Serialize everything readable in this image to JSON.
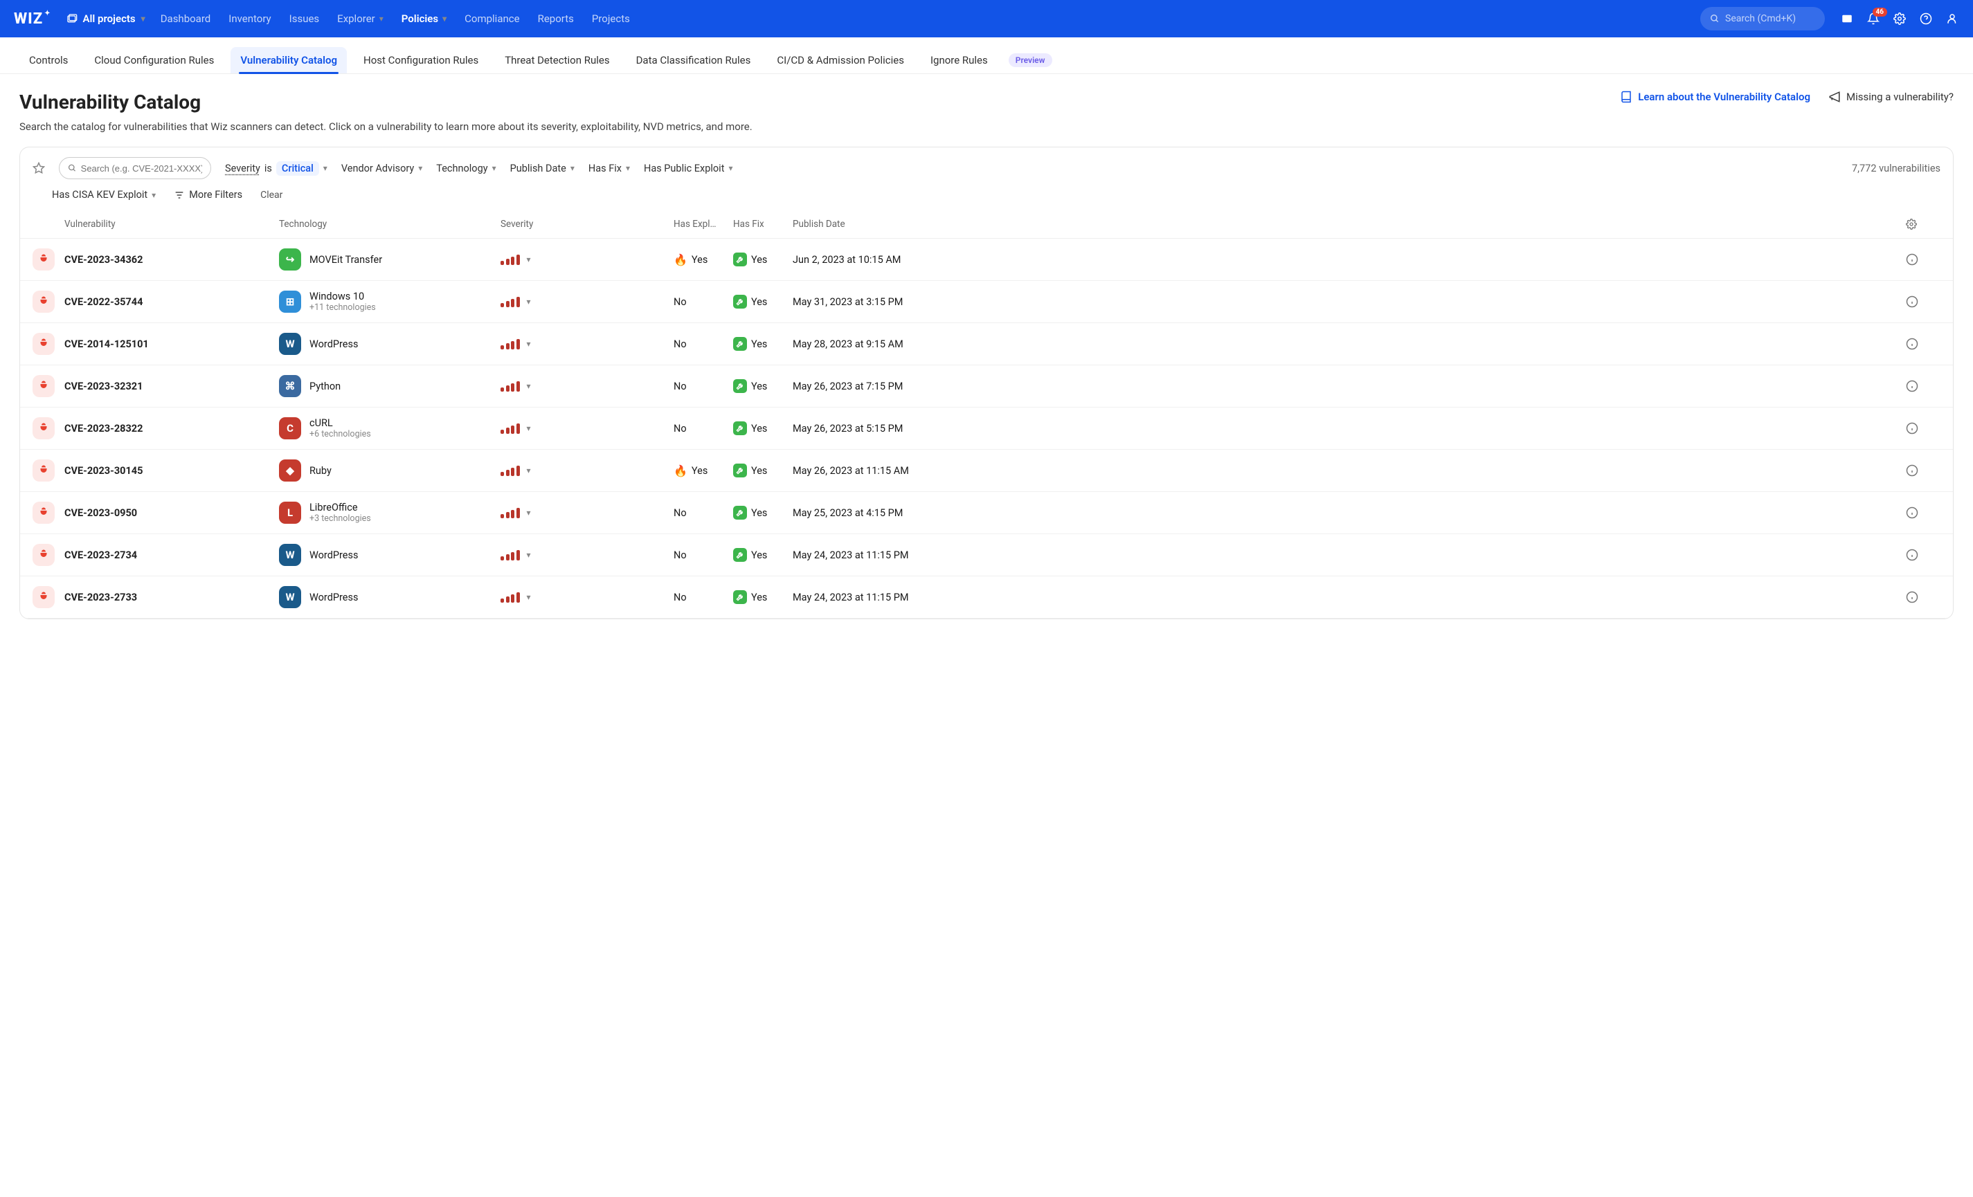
{
  "brand": "WIZ",
  "project_selector": "All projects",
  "nav": {
    "items": [
      "Dashboard",
      "Inventory",
      "Issues",
      "Explorer",
      "Policies",
      "Compliance",
      "Reports",
      "Projects"
    ],
    "active": "Policies",
    "search_placeholder": "Search (Cmd+K)",
    "notification_count": "46"
  },
  "subtabs": {
    "items": [
      "Controls",
      "Cloud Configuration Rules",
      "Vulnerability Catalog",
      "Host Configuration Rules",
      "Threat Detection Rules",
      "Data Classification Rules",
      "CI/CD & Admission Policies",
      "Ignore Rules"
    ],
    "active": "Vulnerability Catalog",
    "preview_label": "Preview"
  },
  "page": {
    "title": "Vulnerability Catalog",
    "learn_link": "Learn about the Vulnerability Catalog",
    "missing_link": "Missing a vulnerability?",
    "description": "Search the catalog for vulnerabilities that Wiz scanners can detect. Click on a vulnerability to learn more about its severity, exploitability, NVD metrics, and more."
  },
  "filters": {
    "search_placeholder": "Search (e.g. CVE-2021-XXXX)",
    "severity_label": "Severity",
    "is_label": "is",
    "severity_value": "Critical",
    "vendor": "Vendor Advisory",
    "technology": "Technology",
    "publish": "Publish Date",
    "has_fix": "Has Fix",
    "public_exploit": "Has Public Exploit",
    "cisa": "Has CISA KEV Exploit",
    "more": "More Filters",
    "clear": "Clear",
    "count": "7,772 vulnerabilities"
  },
  "columns": {
    "vuln": "Vulnerability",
    "tech": "Technology",
    "sev": "Severity",
    "expl": "Has Expl…",
    "fix": "Has Fix",
    "date": "Publish Date"
  },
  "rows": [
    {
      "cve": "CVE-2023-34362",
      "tech": "MOVEit Transfer",
      "sub": "",
      "color": "#3cb54b",
      "glyph": "↪",
      "expl": "Yes",
      "fire": true,
      "fix": "Yes",
      "date": "Jun 2, 2023 at 10:15 AM"
    },
    {
      "cve": "CVE-2022-35744",
      "tech": "Windows 10",
      "sub": "+11 technologies",
      "color": "#2f8fd8",
      "glyph": "⊞",
      "expl": "No",
      "fire": false,
      "fix": "Yes",
      "date": "May 31, 2023 at 3:15 PM"
    },
    {
      "cve": "CVE-2014-125101",
      "tech": "WordPress",
      "sub": "",
      "color": "#1a5a8a",
      "glyph": "W",
      "expl": "No",
      "fire": false,
      "fix": "Yes",
      "date": "May 28, 2023 at 9:15 AM"
    },
    {
      "cve": "CVE-2023-32321",
      "tech": "Python",
      "sub": "",
      "color": "#3b6aa0",
      "glyph": "⌘",
      "expl": "No",
      "fire": false,
      "fix": "Yes",
      "date": "May 26, 2023 at 7:15 PM"
    },
    {
      "cve": "CVE-2023-28322",
      "tech": "cURL",
      "sub": "+6 technologies",
      "color": "#c53b2e",
      "glyph": "C",
      "expl": "No",
      "fire": false,
      "fix": "Yes",
      "date": "May 26, 2023 at 5:15 PM"
    },
    {
      "cve": "CVE-2023-30145",
      "tech": "Ruby",
      "sub": "",
      "color": "#c53b2e",
      "glyph": "◆",
      "expl": "Yes",
      "fire": true,
      "fix": "Yes",
      "date": "May 26, 2023 at 11:15 AM"
    },
    {
      "cve": "CVE-2023-0950",
      "tech": "LibreOffice",
      "sub": "+3 technologies",
      "color": "#c53b2e",
      "glyph": "L",
      "expl": "No",
      "fire": false,
      "fix": "Yes",
      "date": "May 25, 2023 at 4:15 PM"
    },
    {
      "cve": "CVE-2023-2734",
      "tech": "WordPress",
      "sub": "",
      "color": "#1a5a8a",
      "glyph": "W",
      "expl": "No",
      "fire": false,
      "fix": "Yes",
      "date": "May 24, 2023 at 11:15 PM"
    },
    {
      "cve": "CVE-2023-2733",
      "tech": "WordPress",
      "sub": "",
      "color": "#1a5a8a",
      "glyph": "W",
      "expl": "No",
      "fire": false,
      "fix": "Yes",
      "date": "May 24, 2023 at 11:15 PM"
    }
  ]
}
